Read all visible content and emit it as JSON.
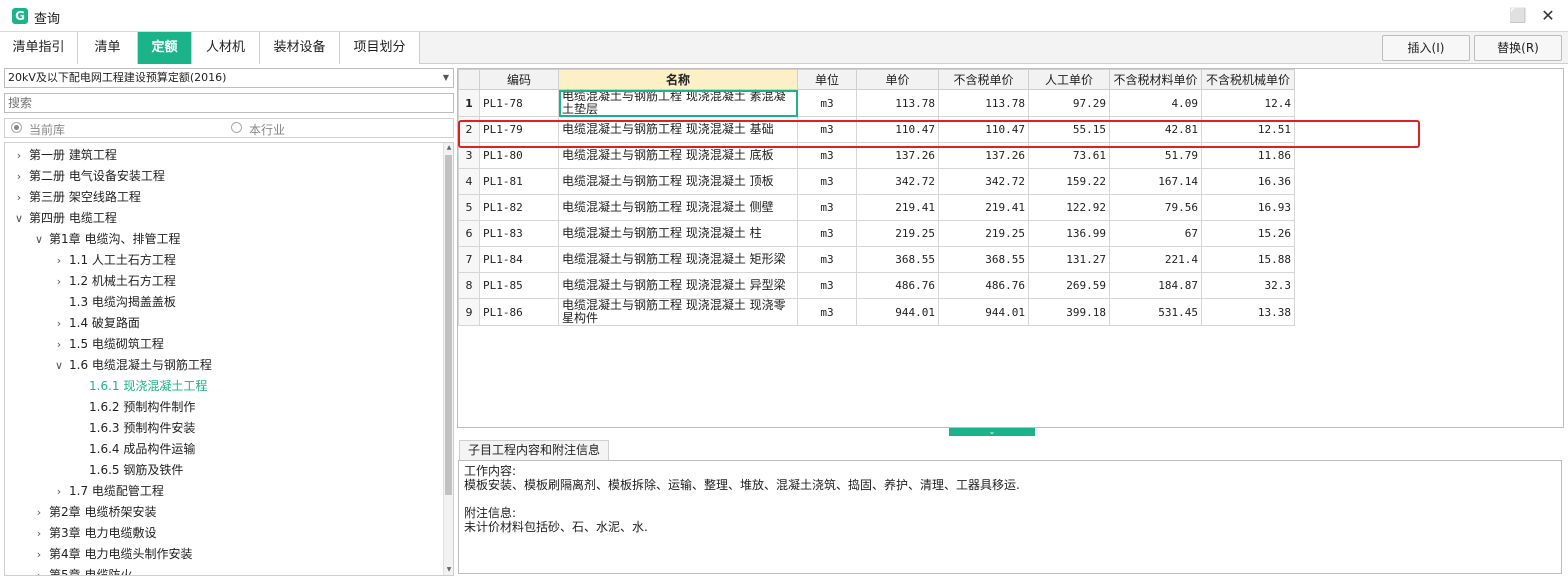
{
  "window": {
    "title": "查询",
    "logo": "G",
    "minimize_icon": "minimize-icon",
    "close_icon": "close-icon"
  },
  "tabs": [
    {
      "label": "清单指引",
      "active": false
    },
    {
      "label": "清单",
      "active": false
    },
    {
      "label": "定额",
      "active": true
    },
    {
      "label": "人材机",
      "active": false
    },
    {
      "label": "装材设备",
      "active": false
    },
    {
      "label": "项目划分",
      "active": false
    }
  ],
  "toolbar": {
    "insert_label": "插入(I)",
    "replace_label": "替换(R)"
  },
  "left": {
    "quota_library": "20kV及以下配电网工程建设预算定额(2016)",
    "search_placeholder": "搜索",
    "scope_current": "当前库",
    "scope_industry": "本行业",
    "tree": [
      {
        "label": "第一册 建筑工程",
        "level": 0,
        "state": "collapsed"
      },
      {
        "label": "第二册 电气设备安装工程",
        "level": 0,
        "state": "collapsed"
      },
      {
        "label": "第三册 架空线路工程",
        "level": 0,
        "state": "collapsed"
      },
      {
        "label": "第四册 电缆工程",
        "level": 0,
        "state": "expanded"
      },
      {
        "label": "第1章 电缆沟、排管工程",
        "level": 1,
        "state": "expanded"
      },
      {
        "label": "1.1 人工土石方工程",
        "level": 2,
        "state": "collapsed"
      },
      {
        "label": "1.2 机械土石方工程",
        "level": 2,
        "state": "collapsed"
      },
      {
        "label": "1.3 电缆沟揭盖盖板",
        "level": 2,
        "state": "leaf"
      },
      {
        "label": "1.4 破复路面",
        "level": 2,
        "state": "collapsed"
      },
      {
        "label": "1.5 电缆砌筑工程",
        "level": 2,
        "state": "collapsed"
      },
      {
        "label": "1.6 电缆混凝土与钢筋工程",
        "level": 2,
        "state": "expanded"
      },
      {
        "label": "1.6.1 现浇混凝土工程",
        "level": 3,
        "state": "leaf",
        "selected": true
      },
      {
        "label": "1.6.2 预制构件制作",
        "level": 3,
        "state": "leaf"
      },
      {
        "label": "1.6.3 预制构件安装",
        "level": 3,
        "state": "leaf"
      },
      {
        "label": "1.6.4 成品构件运输",
        "level": 3,
        "state": "leaf"
      },
      {
        "label": "1.6.5 钢筋及铁件",
        "level": 3,
        "state": "leaf"
      },
      {
        "label": "1.7 电缆配管工程",
        "level": 2,
        "state": "collapsed"
      },
      {
        "label": "第2章 电缆桥架安装",
        "level": 1,
        "state": "collapsed"
      },
      {
        "label": "第3章 电力电缆敷设",
        "level": 1,
        "state": "collapsed"
      },
      {
        "label": "第4章 电力电缆头制作安装",
        "level": 1,
        "state": "collapsed"
      },
      {
        "label": "第5章 电缆防火",
        "level": 1,
        "state": "collapsed"
      }
    ]
  },
  "grid": {
    "columns": [
      "编码",
      "名称",
      "单位",
      "单价",
      "不含税单价",
      "人工单价",
      "不含税材料单价",
      "不含税机械单价"
    ],
    "rows": [
      {
        "n": "1",
        "code": "PL1-78",
        "name": "电缆混凝土与钢筋工程 现浇混凝土 素混凝土垫层",
        "unit": "m3",
        "price": "113.78",
        "price_ex": "113.78",
        "labor": "97.29",
        "material": "4.09",
        "machine": "12.4"
      },
      {
        "n": "2",
        "code": "PL1-79",
        "name": "电缆混凝土与钢筋工程 现浇混凝土 基础",
        "unit": "m3",
        "price": "110.47",
        "price_ex": "110.47",
        "labor": "55.15",
        "material": "42.81",
        "machine": "12.51"
      },
      {
        "n": "3",
        "code": "PL1-80",
        "name": "电缆混凝土与钢筋工程 现浇混凝土 底板",
        "unit": "m3",
        "price": "137.26",
        "price_ex": "137.26",
        "labor": "73.61",
        "material": "51.79",
        "machine": "11.86"
      },
      {
        "n": "4",
        "code": "PL1-81",
        "name": "电缆混凝土与钢筋工程 现浇混凝土 顶板",
        "unit": "m3",
        "price": "342.72",
        "price_ex": "342.72",
        "labor": "159.22",
        "material": "167.14",
        "machine": "16.36"
      },
      {
        "n": "5",
        "code": "PL1-82",
        "name": "电缆混凝土与钢筋工程 现浇混凝土 侧壁",
        "unit": "m3",
        "price": "219.41",
        "price_ex": "219.41",
        "labor": "122.92",
        "material": "79.56",
        "machine": "16.93"
      },
      {
        "n": "6",
        "code": "PL1-83",
        "name": "电缆混凝土与钢筋工程 现浇混凝土 柱",
        "unit": "m3",
        "price": "219.25",
        "price_ex": "219.25",
        "labor": "136.99",
        "material": "67",
        "machine": "15.26"
      },
      {
        "n": "7",
        "code": "PL1-84",
        "name": "电缆混凝土与钢筋工程 现浇混凝土 矩形梁",
        "unit": "m3",
        "price": "368.55",
        "price_ex": "368.55",
        "labor": "131.27",
        "material": "221.4",
        "machine": "15.88"
      },
      {
        "n": "8",
        "code": "PL1-85",
        "name": "电缆混凝土与钢筋工程 现浇混凝土 异型梁",
        "unit": "m3",
        "price": "486.76",
        "price_ex": "486.76",
        "labor": "269.59",
        "material": "184.87",
        "machine": "32.3"
      },
      {
        "n": "9",
        "code": "PL1-86",
        "name": "电缆混凝土与钢筋工程 现浇混凝土 现浇零星构件",
        "unit": "m3",
        "price": "944.01",
        "price_ex": "944.01",
        "labor": "399.18",
        "material": "531.45",
        "machine": "13.38"
      }
    ]
  },
  "info": {
    "tab_label": "子目工程内容和附注信息",
    "work_title": "工作内容:",
    "work_text": "模板安装、模板刷隔离剂、模板拆除、运输、整理、堆放、混凝土浇筑、捣固、养护、清理、工器具移运.",
    "note_title": "附注信息:",
    "note_text": "未计价材料包括砂、石、水泥、水."
  },
  "colors": {
    "accent": "#1bb38a",
    "highlight": "#e02020"
  }
}
